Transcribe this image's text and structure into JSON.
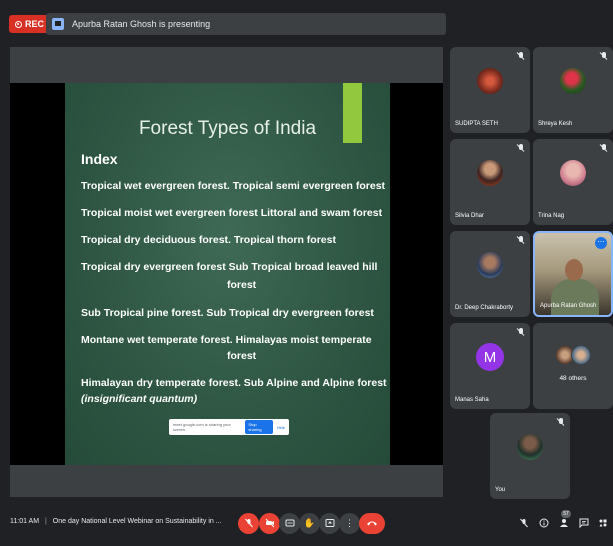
{
  "recording": {
    "label": "REC"
  },
  "presenting_banner": {
    "text": "Apurba Ratan Ghosh is presenting"
  },
  "slide": {
    "title": "Forest Types of India",
    "index_heading": "Index",
    "lines": [
      "Tropical wet evergreen forest.  Tropical semi evergreen forest",
      "Tropical moist wet evergreen forest Littoral and swam forest",
      "Tropical dry deciduous forest.  Tropical thorn forest",
      "Tropical dry evergreen forest    Sub Tropical broad leaved hill",
      "forest",
      "Sub Tropical pine forest.  Sub Tropical dry evergreen forest",
      "Montane wet temperate forest. Himalayas moist temperate",
      "forest",
      "Himalayan dry temperate forest.  Sub Alpine and Alpine forest",
      "(insignificant quantum)"
    ],
    "share_bar": {
      "message": "meet.google.com is sharing your screen.",
      "stop_label": "Stop sharing",
      "hide_label": "Hide"
    }
  },
  "participants": [
    {
      "name": "SUDIPTA SETH",
      "muted": true
    },
    {
      "name": "Shreya Kesh",
      "muted": true
    },
    {
      "name": "Silvia Dhar",
      "muted": true
    },
    {
      "name": "Trina Nag",
      "muted": true
    },
    {
      "name": "Dr. Deep Chakraborty",
      "muted": true
    },
    {
      "name": "Apurba Ratan Ghosh",
      "muted": false,
      "active_speaker": true
    },
    {
      "name": "Manas Saha",
      "initial": "M",
      "muted": true
    },
    {
      "others_label": "48 others"
    },
    {
      "name": "You",
      "muted": true
    }
  ],
  "bottom_bar": {
    "time": "11:01 AM",
    "separator": "|",
    "meeting_title": "One day National Level Webinar on Sustainability in ...",
    "participant_count": "57",
    "controls": [
      "mic-off",
      "camera-off",
      "captions",
      "raise-hand",
      "present",
      "more-options",
      "leave-call"
    ]
  },
  "colors": {
    "background": "#202124",
    "tile": "#3c4043",
    "rec_red": "#d93025",
    "leave_red": "#ea4335",
    "accent_blue": "#1a73e8",
    "slide_green": "#2f5744",
    "slide_accent": "#92c83e",
    "avatar_purple": "#9334e6"
  }
}
